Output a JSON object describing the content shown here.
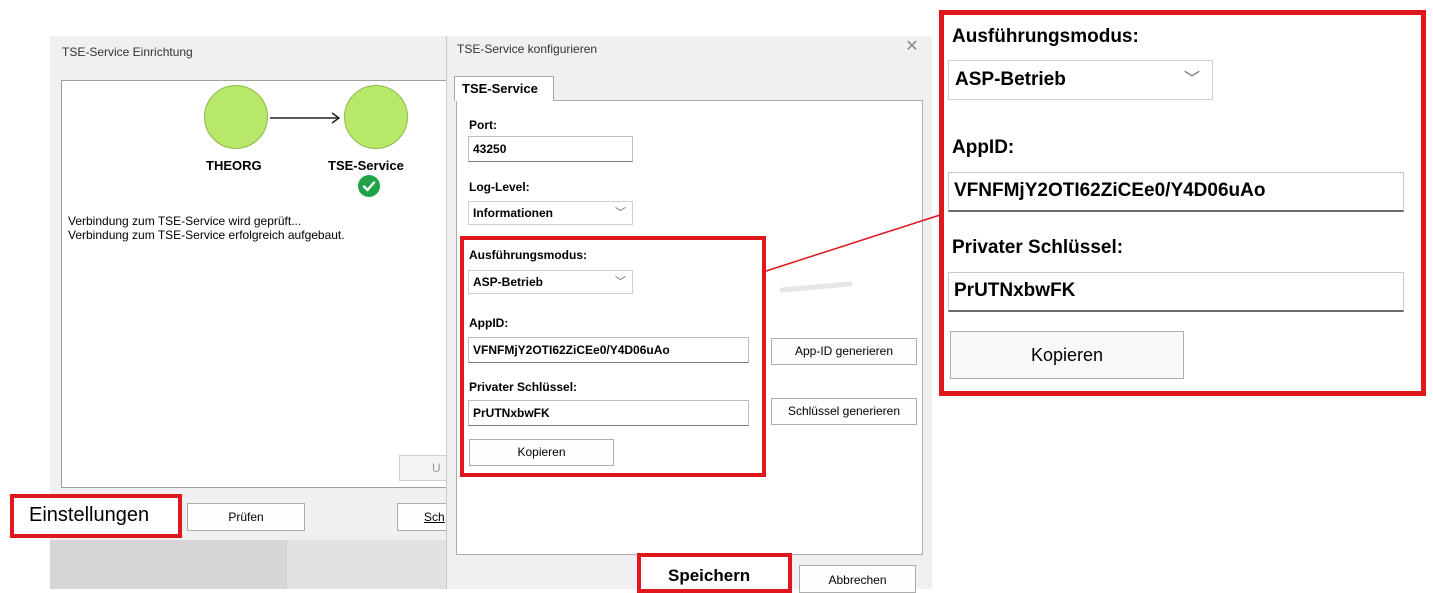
{
  "setup_window": {
    "title": "TSE-Service Einrichtung",
    "node_from": "THEORG",
    "node_to": "TSE-Service",
    "status_lines": [
      "Verbindung zum TSE-Service wird geprüft...",
      "Verbindung zum TSE-Service erfolgreich aufgebaut."
    ],
    "update_button_partial": "U",
    "settings_button": "Einstellungen",
    "check_button": "Prüfen",
    "close_button_partial": "Sch"
  },
  "config_dialog": {
    "title": "TSE-Service konfigurieren",
    "close_glyph": "✕",
    "tab": "TSE-Service",
    "port_label": "Port:",
    "port_value": "43250",
    "loglevel_label": "Log-Level:",
    "loglevel_value": "Informationen",
    "mode_label": "Ausführungsmodus:",
    "mode_value": "ASP-Betrieb",
    "appid_label": "AppID:",
    "appid_value": "VFNFMjY2OTI62ZiCEe0/Y4D06uAo",
    "appid_generate_button": "App-ID generieren",
    "key_label": "Privater Schlüssel:",
    "key_value": "PrUTNxbwFK",
    "key_generate_button": "Schlüssel generieren",
    "copy_button": "Kopieren",
    "save_button": "Speichern",
    "cancel_button": "Abbrechen"
  },
  "zoom": {
    "mode_label": "Ausführungsmodus:",
    "mode_value": "ASP-Betrieb",
    "appid_label": "AppID:",
    "appid_value": "VFNFMjY2OTI62ZiCEe0/Y4D06uAo",
    "key_label": "Privater Schlüssel:",
    "key_value": "PrUTNxbwFK",
    "copy_button": "Kopieren"
  },
  "icons": {
    "chevron": "chevron-down-icon",
    "check": "check-circle-icon",
    "arrow": "arrow-right-icon"
  },
  "colors": {
    "highlight_red": "#e0171d",
    "node_green": "#b7e86a",
    "check_green": "#1ea446"
  }
}
